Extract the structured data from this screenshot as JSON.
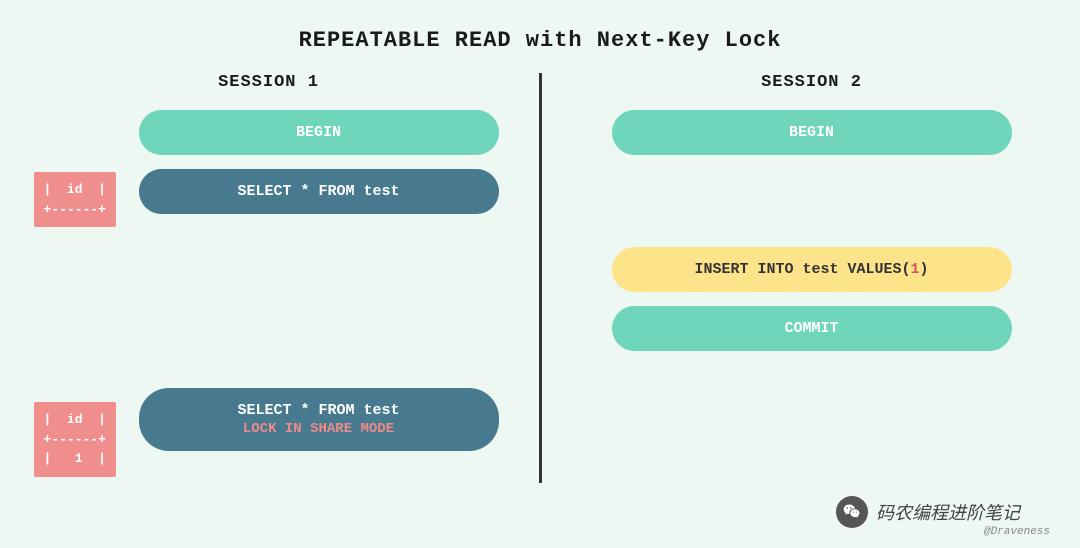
{
  "title": "REPEATABLE READ with Next-Key Lock",
  "session1": {
    "label": "SESSION 1",
    "begin": "BEGIN",
    "select1": "SELECT * FROM test",
    "select2_line1": "SELECT * FROM test",
    "select2_line2": "LOCK IN SHARE MODE",
    "result1": "|  id  |\n+------+",
    "result2": "|  id  |\n+------+\n|   1  |"
  },
  "session2": {
    "label": "SESSION 2",
    "begin": "BEGIN",
    "insert_pre": "INSERT INTO test VALUES(",
    "insert_val": "1",
    "insert_post": ")",
    "commit": "COMMIT"
  },
  "credit": "@Draveness",
  "watermark": "码农编程进阶笔记"
}
